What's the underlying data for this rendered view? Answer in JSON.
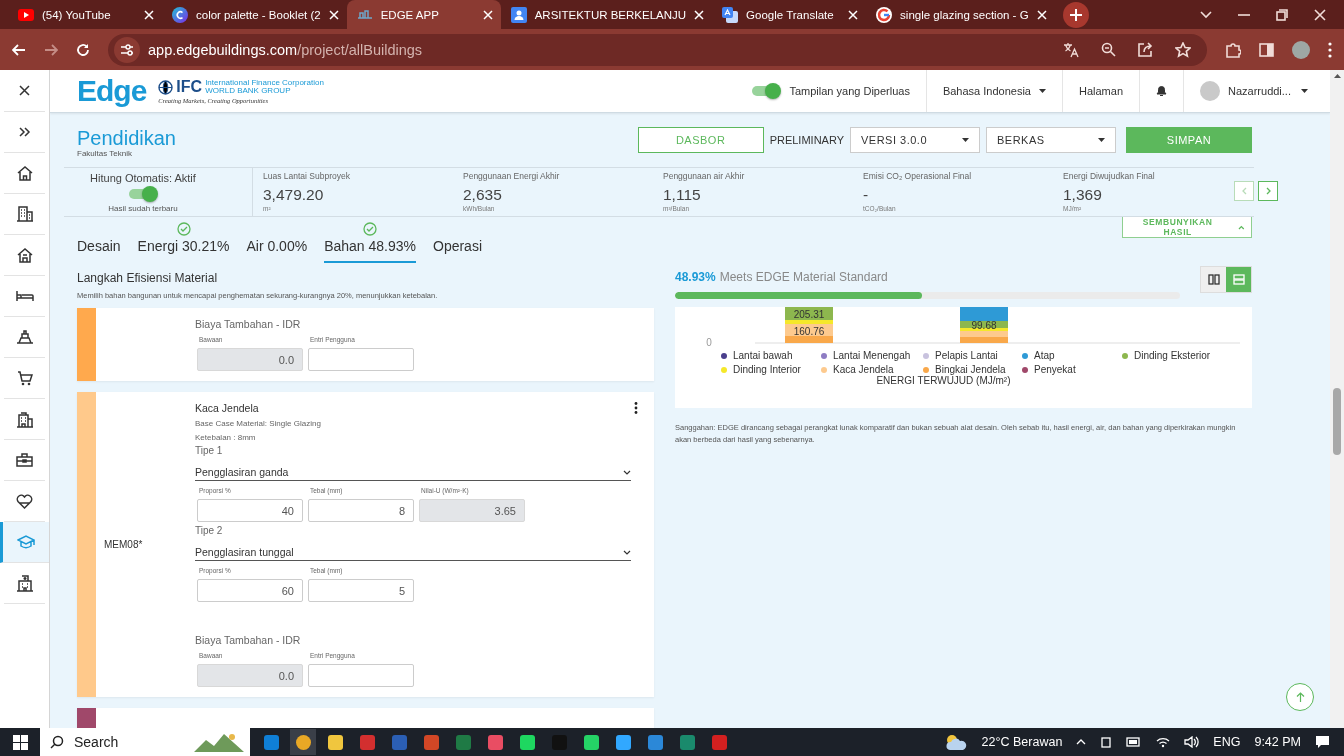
{
  "browser": {
    "tabs": [
      {
        "kind": "video",
        "title": "(54) YouTube",
        "selected": false
      },
      {
        "kind": "palette",
        "title": "color palette - Booklet (2",
        "selected": false
      },
      {
        "kind": "app",
        "title": "EDGE APP",
        "selected": true
      },
      {
        "kind": "profile",
        "title": "ARSITEKTUR BERKELANJU",
        "selected": false
      },
      {
        "kind": "translate",
        "title": "Google Translate",
        "selected": false
      },
      {
        "kind": "search",
        "title": "single glazing section - G",
        "selected": false
      }
    ],
    "url_host": "app.edgebuildings.com",
    "url_path": "/project/allBuildings"
  },
  "sidebar": {
    "items": [
      {
        "kind": "home",
        "selected": false
      },
      {
        "kind": "apartment",
        "selected": false
      },
      {
        "kind": "house",
        "selected": false
      },
      {
        "kind": "bed",
        "selected": false
      },
      {
        "kind": "warehouse",
        "selected": false
      },
      {
        "kind": "cart",
        "selected": false
      },
      {
        "kind": "office",
        "selected": false
      },
      {
        "kind": "briefcase",
        "selected": false
      },
      {
        "kind": "heart",
        "selected": false
      },
      {
        "kind": "cap",
        "selected": true
      },
      {
        "kind": "hospital",
        "selected": false
      }
    ]
  },
  "app_header": {
    "logo": "Edge",
    "ifc": "IFC",
    "ifc_name": "International Finance Corporation",
    "ifc_group": "WORLD BANK GROUP",
    "tagline": "Creating Markets, Creating Opportunities",
    "expanded_view": {
      "label": "Tampilan yang Diperluas",
      "on": true
    },
    "language": "Bahasa Indonesia",
    "pages": "Halaman",
    "user": "Nazarruddi..."
  },
  "project": {
    "title": "Pendidikan",
    "subtitle": "Fakultas Teknik",
    "dashboard": "DASBOR",
    "phase": "PRELIMINARY",
    "version": "VERSI 3.0.0",
    "files": "BERKAS",
    "save": "SIMPAN"
  },
  "auto_calc": {
    "label": "Hitung Otomatis: Aktif",
    "on": true,
    "status": "Hasil sudah terbaru"
  },
  "metrics": [
    {
      "label": "Luas Lantai Subproyek",
      "value": "3,479.20",
      "unit": "m²"
    },
    {
      "label": "Penggunaan Energi Akhir",
      "value": "2,635",
      "unit": "kWh/Bulan"
    },
    {
      "label": "Penggunaan air Akhir",
      "value": "1,115",
      "unit": "m³/Bulan"
    },
    {
      "label": "Emisi CO₂ Operasional Final",
      "value": "-",
      "unit": "tCO₂/Bulan"
    },
    {
      "label": "Energi Diwujudkan Final",
      "value": "1,369",
      "unit": "MJ/m²"
    }
  ],
  "results_toggle": "SEMBUNYIKAN HASIL",
  "tabs": [
    {
      "label": "Desain",
      "passed": false,
      "selected": false
    },
    {
      "label": "Energi 30.21%",
      "passed": true,
      "selected": false
    },
    {
      "label": "Air 0.00%",
      "passed": false,
      "selected": false
    },
    {
      "label": "Bahan 48.93%",
      "passed": true,
      "selected": true
    },
    {
      "label": "Operasi",
      "passed": false,
      "selected": false
    }
  ],
  "section": {
    "title": "Langkah Efisiensi Material",
    "description": "Memilih bahan bangunan untuk mencapai penghematan sekurang-kurangnya 20%, menunjukkan ketebalan."
  },
  "materials": [
    {
      "color": "#ffa94d",
      "cost": {
        "title": "Biaya Tambahan - IDR",
        "default_label": "Bawaan",
        "default_value": "0.0",
        "user_label": "Entri Pengguna"
      }
    },
    {
      "color": "#ffc98b",
      "code": "MEM08*",
      "title": "Kaca Jendela",
      "base": "Base Case Material: Single Glazing",
      "thickness": "Ketebalan : 8mm",
      "types": [
        {
          "label": "Tipe 1",
          "selection": "Pengglasiran ganda",
          "fields": [
            {
              "label": "Proporsi %",
              "value": "40",
              "disabled": false
            },
            {
              "label": "Tebal (mm)",
              "value": "8",
              "disabled": false
            },
            {
              "label": "Nilai-U (W/m²·K)",
              "value": "3.65",
              "disabled": true
            }
          ]
        },
        {
          "label": "Tipe 2",
          "selection": "Pengglasiran tunggal",
          "fields": [
            {
              "label": "Proporsi %",
              "value": "60",
              "disabled": false
            },
            {
              "label": "Tebal (mm)",
              "value": "5",
              "disabled": false
            }
          ]
        }
      ],
      "cost": {
        "title": "Biaya Tambahan - IDR",
        "default_label": "Bawaan",
        "default_value": "0.0",
        "user_label": "Entri Pengguna"
      }
    },
    {
      "color": "#a0486a"
    }
  ],
  "result": {
    "percent": "48.93%",
    "standard": "Meets EDGE Material Standard",
    "level": 0.49,
    "view_options": [
      {
        "kind": "columns",
        "selected": false
      },
      {
        "kind": "rows",
        "selected": true
      }
    ],
    "bar_labels": [
      "205.31",
      "160.76",
      "99.68"
    ],
    "axis_zero": "0",
    "legend": [
      {
        "label": "Lantai bawah",
        "color": "#4a3f8c"
      },
      {
        "label": "Lantai Menengah",
        "color": "#8e7cc3"
      },
      {
        "label": "Pelapis Lantai",
        "color": "#c8c2de"
      },
      {
        "label": "Atap",
        "color": "#2e9ad6"
      },
      {
        "label": "Dinding Eksterior",
        "color": "#8db74e"
      },
      {
        "label": "Dinding Interior",
        "color": "#f5e82a"
      },
      {
        "label": "Kaca Jendela",
        "color": "#fdca8e"
      },
      {
        "label": "Bingkai Jendela",
        "color": "#f9a84a"
      },
      {
        "label": "Penyekat",
        "color": "#a0486a"
      }
    ],
    "axis_title": "ENERGI TERWUJUD (MJ/m²)",
    "disclaimer": "Sanggahan: EDGE dirancang sebagai perangkat lunak komparatif dan bukan sebuah alat desain. Oleh sebab itu, hasil energi, air, dan bahan yang diperkirakan mungkin akan berbeda dari hasil yang sebenarnya."
  },
  "taskbar": {
    "search": "Search",
    "weather": "22°C Berawan",
    "language": "ENG",
    "time": "9:42 PM"
  }
}
